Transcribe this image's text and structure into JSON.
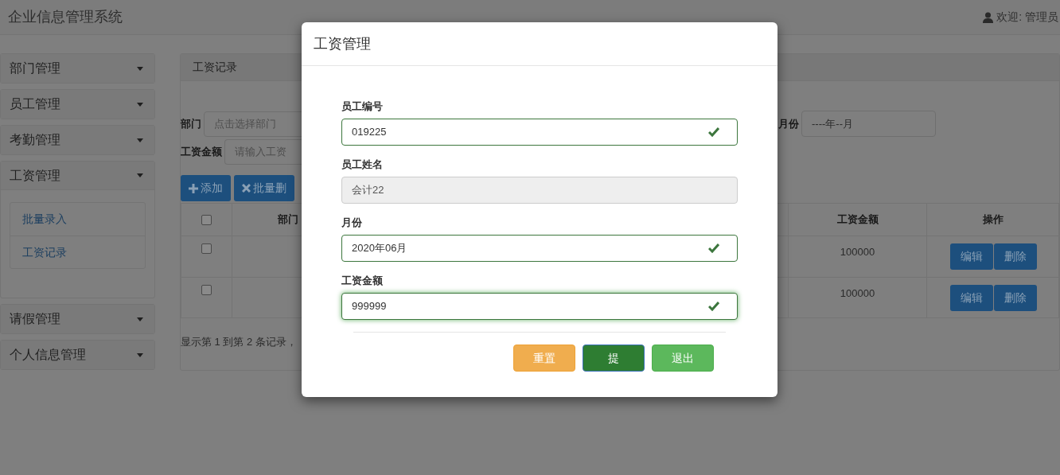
{
  "app_title": "企业信息管理系统",
  "user": {
    "greeting": "欢迎: 管理员"
  },
  "sidebar": [
    {
      "label": "部门管理",
      "expanded": false
    },
    {
      "label": "员工管理",
      "expanded": false
    },
    {
      "label": "考勤管理",
      "expanded": false
    },
    {
      "label": "工资管理",
      "expanded": true,
      "children": [
        {
          "label": "批量录入"
        },
        {
          "label": "工资记录"
        }
      ]
    },
    {
      "label": "请假管理",
      "expanded": false
    },
    {
      "label": "个人信息管理",
      "expanded": false
    }
  ],
  "panel": {
    "title": "工资记录",
    "filters": [
      {
        "label": "部门",
        "placeholder": "点击选择部门"
      },
      {
        "label": "工资金额",
        "placeholder": "请输入工资"
      }
    ],
    "month_filter": {
      "label": "月份",
      "placeholder": "----年--月"
    },
    "buttons": [
      {
        "label": "添加",
        "kind": "add"
      },
      {
        "label": "批量删",
        "kind": "delete"
      }
    ],
    "table": {
      "columns": [
        "部门",
        "工资金额",
        "操作"
      ],
      "header_checked": false,
      "rows": [
        {
          "checked": false,
          "amount": "100000",
          "actions": [
            "编辑",
            "删除"
          ]
        },
        {
          "checked": false,
          "amount": "100000",
          "actions": [
            "编辑",
            "删除"
          ]
        }
      ]
    },
    "footer": "显示第 1 到第 2 条记录，"
  },
  "modal": {
    "title": "工资管理",
    "fields": [
      {
        "label": "员工编号",
        "value": "019225",
        "disabled": false,
        "valid": true,
        "focused": false
      },
      {
        "label": "员工姓名",
        "value": "会计22",
        "disabled": true,
        "valid": false,
        "focused": false
      },
      {
        "label": "月份",
        "value": "2020年06月",
        "disabled": false,
        "valid": true,
        "focused": false
      },
      {
        "label": "工资金额",
        "value": "999999",
        "disabled": false,
        "valid": true,
        "focused": true
      }
    ],
    "buttons": [
      {
        "label": "重置",
        "kind": "warning"
      },
      {
        "label": "提",
        "kind": "primary-active"
      },
      {
        "label": "退出",
        "kind": "success"
      }
    ]
  }
}
